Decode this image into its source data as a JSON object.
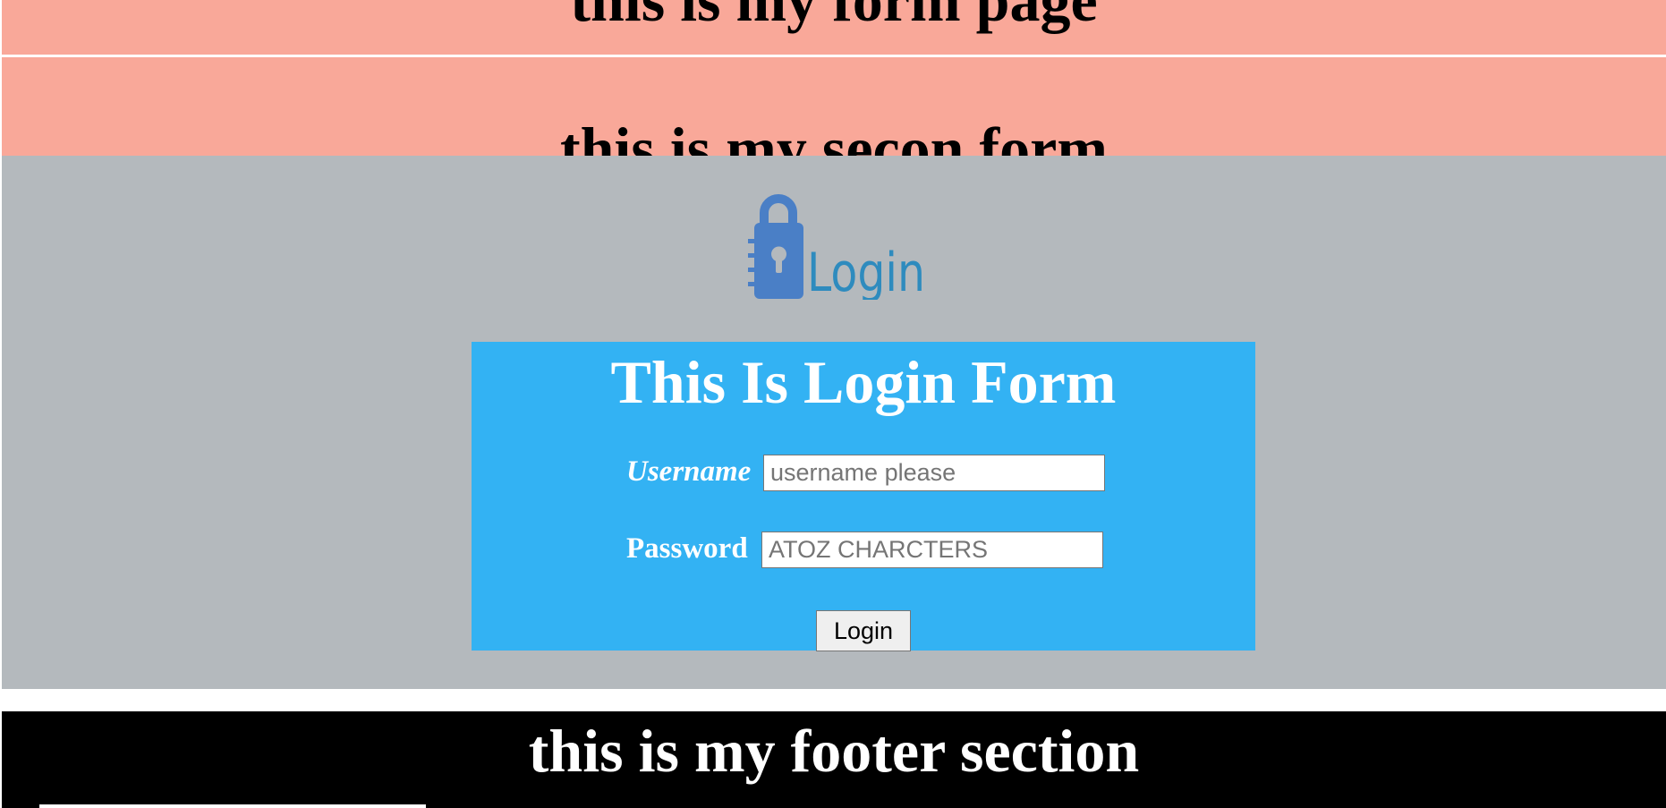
{
  "headers": {
    "primary_title": "this is my form page",
    "secondary_title": "this is my secon form"
  },
  "logo": {
    "text": "Login",
    "icon": "lock-icon",
    "color": "#4a7fc6"
  },
  "login_form": {
    "title": "This Is Login Form",
    "username_label": "Username",
    "username_placeholder": "username please",
    "password_label": "Password",
    "password_placeholder": "ATOZ CHARCTERS",
    "submit_label": "Login"
  },
  "footer": {
    "title": "this is my footer section"
  },
  "colors": {
    "header_bg": "#f9a899",
    "main_bg": "#b4b9bd",
    "form_bg": "#33b2f3",
    "footer_bg": "#000000"
  }
}
